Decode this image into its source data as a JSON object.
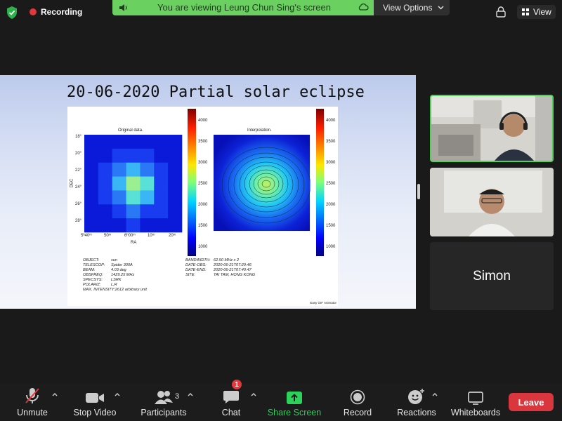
{
  "top": {
    "recording_label": "Recording",
    "banner_text": "You are viewing Leung Chun Sing's screen",
    "view_options_label": "View Options",
    "view_label": "View"
  },
  "slide": {
    "title": "20-06-2020 Partial solar eclipse",
    "panel_left_title": "Original data.",
    "panel_right_title": "Interpolation.",
    "y_axis_label": "DEC",
    "x_axis_label": "RA",
    "y_ticks": [
      "18°",
      "20°",
      "22°",
      "24°",
      "26°",
      "28°"
    ],
    "x_ticks": [
      "5ʰ40ᵐ",
      "50ᵐ",
      "6ʰ00ᵐ",
      "10ᵐ",
      "20ᵐ"
    ],
    "colorbar_ticks": [
      "4000",
      "3500",
      "3000",
      "2500",
      "2000",
      "1500",
      "1000"
    ],
    "meta_left": [
      {
        "k": "OBJECT:",
        "v": "sun"
      },
      {
        "k": "TELESCOP:",
        "v": "Spider 300A"
      },
      {
        "k": "BEAM:",
        "v": "4.03 deg"
      },
      {
        "k": "OBSFREQ:",
        "v": "1429.25 MHz"
      },
      {
        "k": "SPECSYS:",
        "v": "LSRK"
      },
      {
        "k": "POLARIZ:",
        "v": "L,R"
      }
    ],
    "meta_max": "MAX. INTENSITY:2612 arbitrary unit",
    "meta_right": [
      {
        "k": "BANDWIDTH:",
        "v": "62.50 MHz x 2"
      },
      {
        "k": "DATE-OBS:",
        "v": "2020-06-21T07:29:46"
      },
      {
        "k": "DATE-END:",
        "v": "2020-06-21T07:40:47"
      },
      {
        "k": "SITE:",
        "v": "TAI TAM, HONG KONG"
      }
    ],
    "watermark": "Easy GIF Animator"
  },
  "participants": {
    "tile3_name": "Simon",
    "count": "3"
  },
  "toolbar": {
    "unmute": "Unmute",
    "stop_video": "Stop Video",
    "participants": "Participants",
    "chat": "Chat",
    "chat_badge": "1",
    "share_screen": "Share Screen",
    "record": "Record",
    "reactions": "Reactions",
    "whiteboards": "Whiteboards",
    "leave": "Leave"
  },
  "colors": {
    "green": "#6ad160",
    "share_green": "#2bd15a",
    "red": "#d9363e"
  }
}
